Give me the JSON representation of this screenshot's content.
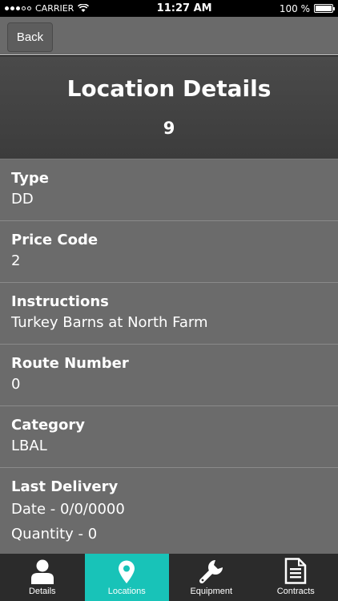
{
  "status_bar": {
    "carrier": "CARRIER",
    "time": "11:27 AM",
    "battery": "100 %"
  },
  "nav": {
    "back_label": "Back"
  },
  "header": {
    "title": "Location Details",
    "subtitle": "9"
  },
  "fields": [
    {
      "label": "Type",
      "value": "DD"
    },
    {
      "label": "Price Code",
      "value": "2"
    },
    {
      "label": "Instructions",
      "value": "Turkey Barns at North Farm"
    },
    {
      "label": "Route Number",
      "value": "0"
    },
    {
      "label": "Category",
      "value": "LBAL"
    }
  ],
  "last_delivery": {
    "label": "Last Delivery",
    "date": "Date - 0/0/0000",
    "quantity": "Quantity - 0"
  },
  "tabs": [
    {
      "label": "Details",
      "icon": "person-icon"
    },
    {
      "label": "Locations",
      "icon": "map-pin-icon",
      "active": true
    },
    {
      "label": "Equipment",
      "icon": "wrench-icon"
    },
    {
      "label": "Contracts",
      "icon": "document-icon"
    }
  ],
  "colors": {
    "accent": "#18c3b8",
    "content_bg": "#6b6b6b",
    "header_bg": "#444444",
    "tabbar_bg": "#2b2b2b"
  }
}
